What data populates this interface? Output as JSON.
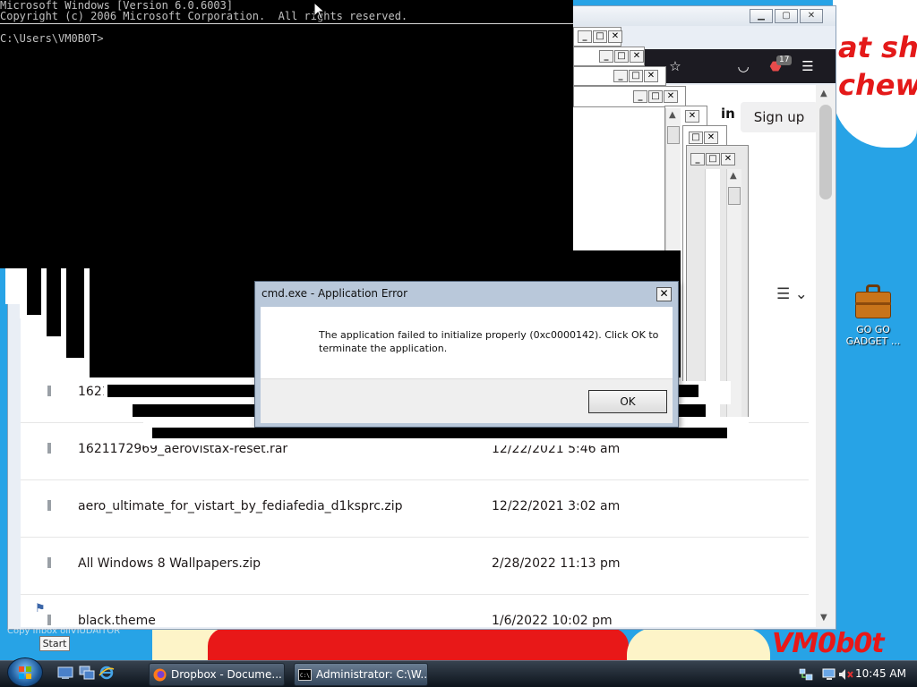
{
  "wallpaper": {
    "text_top": "at shit\nchew",
    "text_bottom": "VM0b0t"
  },
  "desktop_icon": {
    "label": "GO GO\nGADGET ..."
  },
  "cmd": {
    "lines": "Microsoft Windows [Version 6.0.6003]\nCopyright (c) 2006 Microsoft Corporation.  All rights reserved.",
    "prompt": "C:\\Users\\VM0B0T>"
  },
  "firefox": {
    "badge": "17",
    "signin": "in",
    "signup": "Sign up",
    "files": [
      {
        "name": "1621",
        "date": ""
      },
      {
        "name": "1621172969_aerovistax-reset.rar",
        "date": "12/22/2021 5:46 am"
      },
      {
        "name": "aero_ultimate_for_vistart_by_fediafedia_d1ksprc.zip",
        "date": "12/22/2021 3:02 am"
      },
      {
        "name": "All Windows 8 Wallpapers.zip",
        "date": "2/28/2022 11:13 pm"
      },
      {
        "name": "black.theme",
        "date": "1/6/2022 10:02 pm"
      }
    ]
  },
  "error_dialog": {
    "title": "cmd.exe - Application Error",
    "message": "The application failed to initialize properly (0xc0000142). Click OK to terminate the application.",
    "ok": "OK",
    "close": "✕"
  },
  "taskbar": {
    "start_tooltip": "Start",
    "buttons": [
      {
        "label": "Dropbox - Docume..."
      },
      {
        "label": "Administrator: C:\\W..."
      }
    ],
    "clock": "10:45 AM"
  },
  "ghost_text": "Copy Inbox     ollVIUDAITOR"
}
